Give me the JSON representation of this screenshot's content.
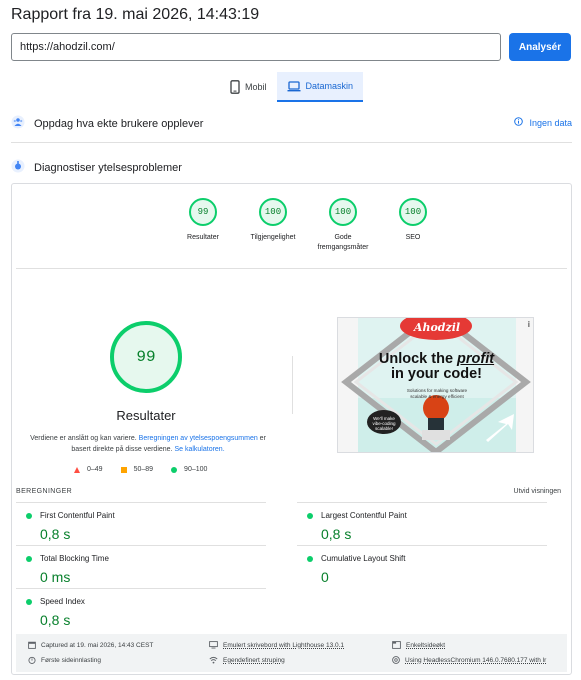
{
  "header": {
    "title": "Rapport fra 19. mai 2026, 14:43:19",
    "url_value": "https://ahodzil.com/",
    "analyze_label": "Analysér"
  },
  "tabs": [
    {
      "label": "Mobil",
      "icon": "phone-icon",
      "active": false
    },
    {
      "label": "Datamaskin",
      "icon": "laptop-icon",
      "active": true
    }
  ],
  "sections": {
    "real_users": "Oppdag hva ekte brukere opplever",
    "no_data": "Ingen data",
    "diagnose": "Diagnostiser ytelsesproblemer"
  },
  "categories": [
    {
      "score": "99",
      "label": "Resultater"
    },
    {
      "score": "100",
      "label": "Tilgjengelighet"
    },
    {
      "score": "100",
      "label": "Gode fremgangsmåter"
    },
    {
      "score": "100",
      "label": "SEO"
    }
  ],
  "performance": {
    "score": "99",
    "label": "Resultater",
    "disclaimer_pre": "Verdiene er anslått og kan variere. ",
    "disclaimer_link1": "Beregningen av ytelsespoengsummen",
    "disclaimer_mid": " er basert direkte på disse verdiene. ",
    "disclaimer_link2": "Se kalkulatoren."
  },
  "legend": [
    {
      "shape": "triangle",
      "range": "0–49",
      "color": "#ff4e42"
    },
    {
      "shape": "square",
      "range": "50–89",
      "color": "#ffa400"
    },
    {
      "shape": "circle",
      "range": "90–100",
      "color": "#0cce6b"
    }
  ],
  "ad": {
    "brand": "Ahodzil",
    "headline1": "Unlock the ",
    "headline_em": "profit",
    "headline2": "in your code!",
    "sub": "Solutions for making software scalable & energy efficient",
    "bubble": "We'll make vibe-coding scalable!",
    "info": "i"
  },
  "metrics_section": {
    "heading": "BEREGNINGER",
    "expand": "Utvid visningen"
  },
  "metrics": [
    {
      "name": "First Contentful Paint",
      "value": "0,8 s"
    },
    {
      "name": "Largest Contentful Paint",
      "value": "0,8 s"
    },
    {
      "name": "Total Blocking Time",
      "value": "0 ms"
    },
    {
      "name": "Cumulative Layout Shift",
      "value": "0"
    },
    {
      "name": "Speed Index",
      "value": "0,8 s"
    }
  ],
  "footer": {
    "captured": "Captured at 19. mai 2026, 14:43 CEST",
    "emulated": "Emulert skrivebord with Lighthouse 13.0.1",
    "single_page": "Enkeltsideøkt",
    "first_load": "Første sideinnlasting",
    "throttling": "Egendefinert struping",
    "browser": "Using HeadlessChromium 146.0.7680.177 with lr"
  },
  "colors": {
    "accent": "#1a73e8",
    "pass": "#0cce6b",
    "pass_text": "#08802c",
    "average": "#ffa400",
    "fail": "#ff4e42"
  }
}
